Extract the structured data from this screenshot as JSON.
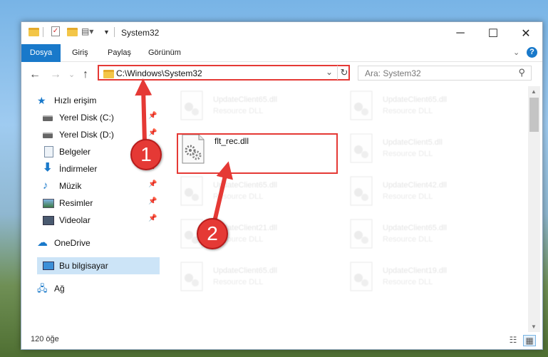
{
  "window": {
    "title": "System32",
    "controls": {
      "minimize": "─",
      "maximize": "☐",
      "close": "✕"
    }
  },
  "ribbon": {
    "tabs": [
      "Dosya",
      "Giriş",
      "Paylaş",
      "Görünüm"
    ],
    "help": "?",
    "expand": "⌄"
  },
  "nav": {
    "back": "←",
    "forward": "→",
    "recent": "⌄",
    "up": "↑",
    "address": "C:\\Windows\\System32",
    "refresh": "↻",
    "search_placeholder": "Ara: System32"
  },
  "sidebar": {
    "quick_access": "Hızlı erişim",
    "items": [
      {
        "label": "Yerel Disk (C:)",
        "icon": "drive-icon",
        "pinned": true
      },
      {
        "label": "Yerel Disk (D:)",
        "icon": "drive-icon",
        "pinned": true
      },
      {
        "label": "Belgeler",
        "icon": "documents-icon",
        "pinned": true
      },
      {
        "label": "İndirmeler",
        "icon": "downloads-icon",
        "pinned": true
      },
      {
        "label": "Müzik",
        "icon": "music-icon",
        "pinned": true
      },
      {
        "label": "Resimler",
        "icon": "pictures-icon",
        "pinned": true
      },
      {
        "label": "Videolar",
        "icon": "videos-icon",
        "pinned": true
      }
    ],
    "onedrive": "OneDrive",
    "this_pc": "Bu bilgisayar",
    "network": "Ağ"
  },
  "files": {
    "highlighted": "flt_rec.dll",
    "left_column": [
      {
        "name": "UpdateClient65.dll",
        "type": "Resource DLL"
      },
      {
        "name": "UpdateClient65.dll",
        "type": "Resource DLL"
      },
      {
        "name": "UpdateClient21.dll",
        "type": "Resource DLL"
      },
      {
        "name": "UpdateClient65.dll",
        "type": "Resource DLL"
      }
    ],
    "right_column": [
      {
        "name": "UpdateClient65.dll",
        "type": "Resource DLL"
      },
      {
        "name": "UpdateClient5.dll",
        "type": "Resource DLL"
      },
      {
        "name": "UpdateClient42.dll",
        "type": "Resource DLL"
      },
      {
        "name": "UpdateClient65.dll",
        "type": "Resource DLL"
      },
      {
        "name": "UpdateClient19.dll",
        "type": "Resource DLL"
      }
    ]
  },
  "status": {
    "count": "120 öğe"
  },
  "callouts": [
    "1",
    "2"
  ],
  "colors": {
    "accent": "#1979ca",
    "highlight": "#e53935",
    "selection": "#cce4f7"
  }
}
